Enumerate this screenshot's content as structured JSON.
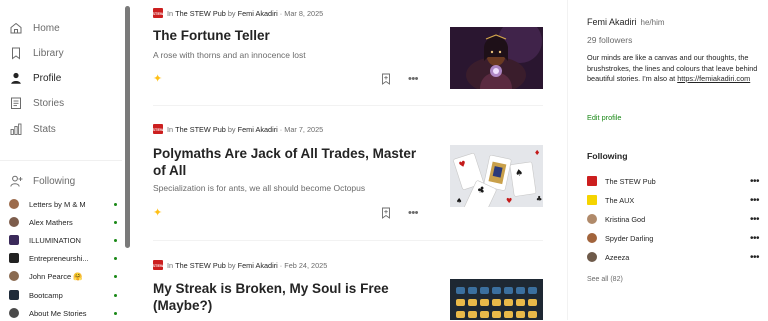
{
  "sidebar": {
    "nav": [
      {
        "label": "Home",
        "icon": "home-icon"
      },
      {
        "label": "Library",
        "icon": "library-icon"
      },
      {
        "label": "Profile",
        "icon": "profile-icon",
        "active": true
      },
      {
        "label": "Stories",
        "icon": "stories-icon"
      },
      {
        "label": "Stats",
        "icon": "stats-icon"
      }
    ],
    "following_label": "Following",
    "following": [
      {
        "label": "Letters by M & M",
        "color": "#9b6a4a",
        "new": true
      },
      {
        "label": "Alex Mathers",
        "color": "#7d5d4c",
        "new": true
      },
      {
        "label": "ILLUMINATION",
        "color": "#3b2a5a",
        "new": true
      },
      {
        "label": "Entrepreneurshi...",
        "color": "#222222",
        "new": true
      },
      {
        "label": "John Pearce 🤗",
        "color": "#8a6a50",
        "new": true
      },
      {
        "label": "Bootcamp",
        "color": "#1f2b3a",
        "new": true
      },
      {
        "label": "About Me Stories",
        "color": "#4a4a4a",
        "new": true
      }
    ]
  },
  "articles": [
    {
      "publication": "The STEW Pub",
      "author": "Femi Akadiri",
      "date": "Mar 8, 2025",
      "title": "The Fortune Teller",
      "subtitle": "A rose with thorns and an innocence lost",
      "thumb": "fortune-teller"
    },
    {
      "publication": "The STEW Pub",
      "author": "Femi Akadiri",
      "date": "Mar 7, 2025",
      "title": "Polymaths Are Jack of All Trades, Master of All",
      "subtitle": "Specialization is for ants, we all should become Octopus",
      "thumb": "playing-cards"
    },
    {
      "publication": "The STEW Pub",
      "author": "Femi Akadiri",
      "date": "Feb 24, 2025",
      "title": "My Streak is Broken, My Soul is Free (Maybe?)",
      "subtitle": "",
      "thumb": "streak-calendar"
    }
  ],
  "meta_words": {
    "in": "In",
    "by": "by",
    "sep": "·"
  },
  "pub_logo_text": "STEW",
  "profile": {
    "name": "Femi Akadiri",
    "pronouns": "he/him",
    "followers": "29 followers",
    "bio": "Our minds are like a canvas and our thoughts, the brushstrokes, the lines and colours that leave behind beautiful stories. I'm also at",
    "bio_link": "https://femiakadiri.com",
    "edit_profile": "Edit profile",
    "following_heading": "Following",
    "following": [
      {
        "label": "The STEW Pub",
        "color": "#cc1f1f",
        "square": true
      },
      {
        "label": "The AUX",
        "color": "#f5d400",
        "square": true
      },
      {
        "label": "Kristina God",
        "color": "#b08a6a",
        "square": false
      },
      {
        "label": "Spyder Darling",
        "color": "#a2643c",
        "square": false
      },
      {
        "label": "Azeeza",
        "color": "#6e5a4a",
        "square": false
      }
    ],
    "see_all": "See all (82)"
  },
  "colors": {
    "accent_green": "#1a8917",
    "stew_red": "#cc1f1f",
    "sparkle": "#ffc017"
  }
}
